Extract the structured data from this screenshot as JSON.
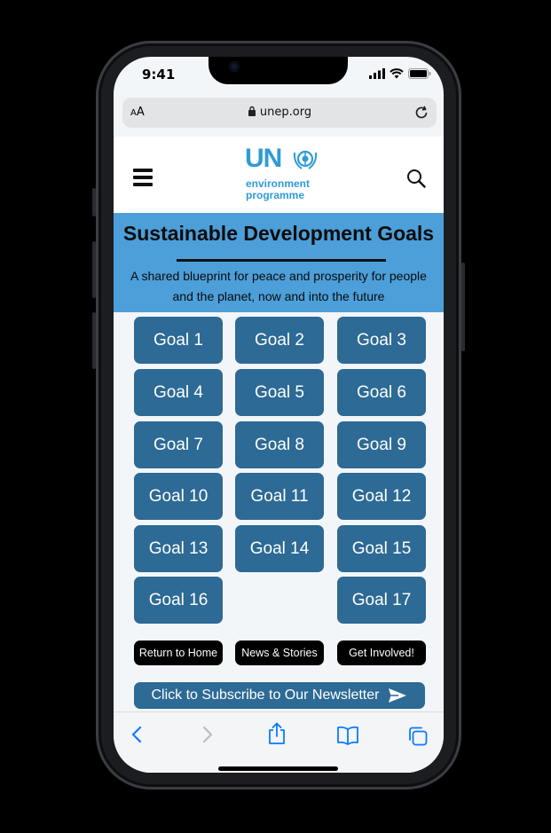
{
  "status": {
    "time": "9:41"
  },
  "browser": {
    "text_size_label": "AA",
    "url": "unep.org"
  },
  "header": {
    "logo_un": "UN",
    "logo_line1": "environment",
    "logo_line2": "programme"
  },
  "hero": {
    "title": "Sustainable Development Goals",
    "subtitle_line1": "A shared blueprint for peace and prosperity for people",
    "subtitle_line2": "and the planet, now and into the future"
  },
  "goals": [
    "Goal 1",
    "Goal 2",
    "Goal 3",
    "Goal 4",
    "Goal 5",
    "Goal 6",
    "Goal 7",
    "Goal 8",
    "Goal 9",
    "Goal 10",
    "Goal 11",
    "Goal 12",
    "Goal 13",
    "Goal 14",
    "Goal 15",
    "Goal 16",
    "Goal 17"
  ],
  "links": {
    "home": "Return to Home",
    "news": "News & Stories",
    "involved": "Get Involved!"
  },
  "subscribe": {
    "label": "Click to Subscribe to Our Newsletter"
  },
  "colors": {
    "accent": "#2d6a95",
    "hero_bg": "#4c9fd9",
    "logo_blue": "#2f9bd6",
    "link_blue": "#0a7aff"
  },
  "icons": {
    "menu": "hamburger-icon",
    "search": "search-icon",
    "lock": "lock-icon",
    "reload": "reload-icon",
    "send": "send-icon",
    "back": "chevron-left-icon",
    "forward": "chevron-right-icon",
    "share": "share-icon",
    "bookmarks": "book-icon",
    "tabs": "tabs-icon"
  }
}
